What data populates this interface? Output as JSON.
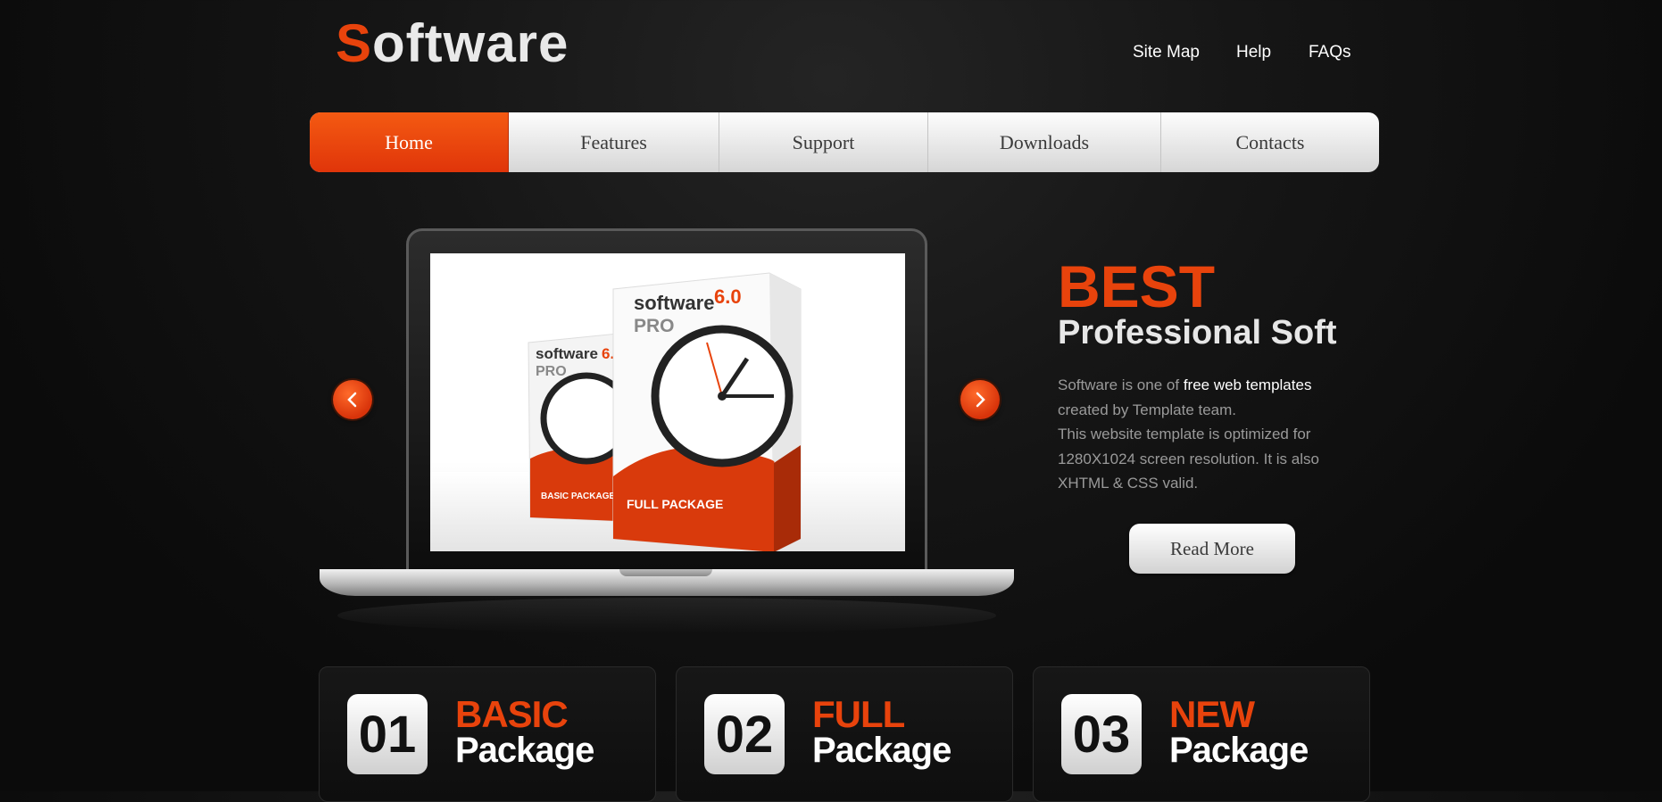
{
  "header": {
    "logo_first_letter": "S",
    "logo_rest": "oftware",
    "links": [
      "Site Map",
      "Help",
      "FAQs"
    ]
  },
  "nav": {
    "items": [
      "Home",
      "Features",
      "Support",
      "Downloads",
      "Contacts"
    ],
    "active": "Home"
  },
  "slider": {
    "prev_icon": "chevron-left-icon",
    "next_icon": "chevron-right-icon",
    "product_box_front": {
      "brand": "software",
      "version": "6.0",
      "edition": "PRO",
      "label": "FULL PACKAGE"
    },
    "product_box_back": {
      "brand": "software",
      "version": "6.",
      "edition": "PRO",
      "label": "BASIC PACKAGE"
    }
  },
  "hero": {
    "title": "BEST",
    "subtitle": "Professional Soft",
    "text_before": "Software is one of ",
    "text_highlight": "free web templates",
    "text_line2": "created by Template team.",
    "text_line3": "This website template is optimized for",
    "text_line4": "1280X1024 screen resolution. It is also",
    "text_line5": "XHTML & CSS valid.",
    "button": "Read More"
  },
  "packages": [
    {
      "number": "01",
      "title": "BASIC",
      "subtitle": "Package"
    },
    {
      "number": "02",
      "title": "FULL",
      "subtitle": "Package"
    },
    {
      "number": "03",
      "title": "NEW",
      "subtitle": "Package"
    }
  ],
  "colors": {
    "accent": "#e8430c",
    "background": "#0c0c0c",
    "nav_bg": "#e6e6e6"
  }
}
